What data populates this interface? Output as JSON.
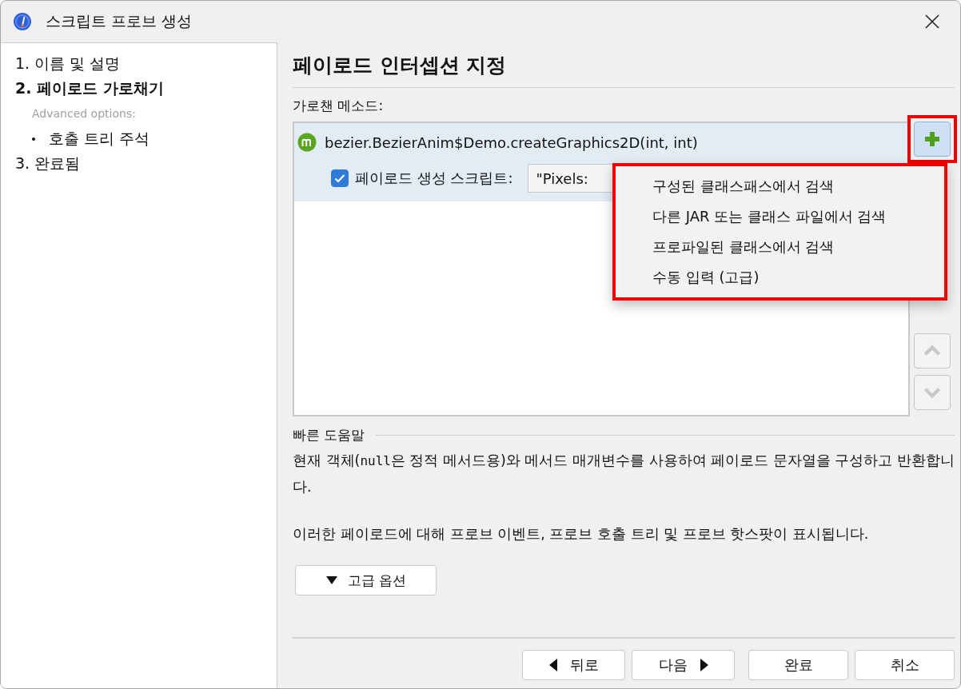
{
  "window": {
    "title": "스크립트 프로브 생성"
  },
  "sidebar": {
    "steps": [
      {
        "label": "1. 이름 및 설명",
        "selected": false
      },
      {
        "label": "2. 페이로드 가로채기",
        "selected": true
      },
      {
        "label": "3. 완료됨",
        "selected": false
      }
    ],
    "advanced_label": "Advanced options:",
    "advanced_items": [
      {
        "label": "호출 트리 주석",
        "selected": false
      }
    ]
  },
  "heading": "페이로드 인터셉션 지정",
  "methods_label": "가로챈 메소드:",
  "methods": [
    {
      "name": "bezier.BezierAnim$Demo.createGraphics2D(int, int)",
      "selected": true,
      "script_checked": true,
      "script_label": "페이로드 생성 스크립트:",
      "script_value": "\"Pixels:"
    }
  ],
  "add_button": {
    "highlighted": true
  },
  "move_up": {
    "disabled": true
  },
  "move_down": {
    "disabled": true
  },
  "add_menu": {
    "highlighted": true,
    "items": [
      {
        "label": "구성된 클래스패스에서 검색"
      },
      {
        "label": "다른 JAR 또는 클래스 파일에서 검색"
      },
      {
        "label": "프로파일된 클래스에서 검색"
      },
      {
        "label": "수동 입력 (고급)"
      }
    ]
  },
  "quick_help": {
    "title": "빠른 도움말",
    "paragraphs": [
      [
        {
          "kind": "text",
          "text": "현재 객체("
        },
        {
          "kind": "code",
          "text": "null"
        },
        {
          "kind": "text",
          "text": "은 정적 메서드용)와 메서드 매개변수를 사용하여 페이로드 문자열을 구성하고 반환합니다."
        }
      ],
      [
        {
          "kind": "text",
          "text": "이러한 페이로드에 대해 프로브 이벤트, 프로브 호출 트리 및 프로브 핫스팟이 표시됩니다."
        }
      ]
    ]
  },
  "advanced_button": {
    "label": "고급 옵션",
    "expanded": false
  },
  "buttons": [
    {
      "label": "뒤로",
      "kind": "back"
    },
    {
      "label": "다음",
      "kind": "next"
    },
    {
      "label": "완료",
      "kind": "plain"
    },
    {
      "label": "취소",
      "kind": "plain"
    }
  ]
}
